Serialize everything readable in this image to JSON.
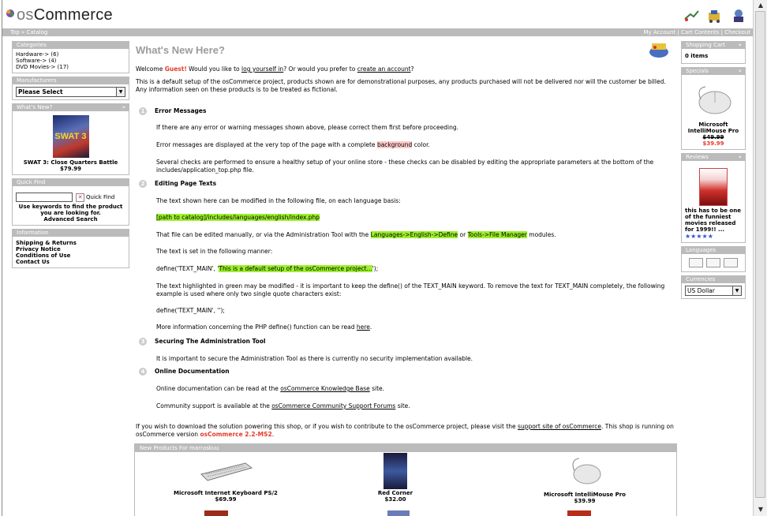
{
  "header": {
    "logo_text_prefix": "os",
    "logo_text_suffix": "Commerce",
    "breadcrumb": "Top » Catalog",
    "nav_right": "My Account | Cart Contents | Checkout"
  },
  "left": {
    "categories": {
      "title": "Categories",
      "items": [
        "Hardware-> (6)",
        "Software-> (4)",
        "DVD Movies-> (17)"
      ]
    },
    "manufacturers": {
      "title": "Manufacturers",
      "selected": "Please Select"
    },
    "whats_new": {
      "title": "What's New?",
      "product": "SWAT 3: Close Quarters Battle",
      "price": "$79.99",
      "img_label": "SWAT 3"
    },
    "quick_find": {
      "title": "Quick Find",
      "button": "Quick Find",
      "hint": "Use keywords to find the product you are looking for.",
      "advanced": "Advanced Search"
    },
    "information": {
      "title": "Information",
      "links": [
        "Shipping & Returns",
        "Privacy Notice",
        "Conditions of Use",
        "Contact Us"
      ]
    }
  },
  "right": {
    "cart": {
      "title": "Shopping Cart",
      "content": "0 items"
    },
    "specials": {
      "title": "Specials",
      "product": "Microsoft IntelliMouse Pro",
      "old_price": "$49.99",
      "new_price": "$39.99"
    },
    "reviews": {
      "title": "Reviews",
      "text": "this has to be one of the funniest movies released for 1999!! ...",
      "stars": "★★★★★"
    },
    "languages": {
      "title": "Languages"
    },
    "currencies": {
      "title": "Currencies",
      "selected": "US Dollar"
    }
  },
  "center": {
    "title": "What's New Here?",
    "welcome_pre": "Welcome ",
    "welcome_guest": "Guest!",
    "welcome_mid": " Would you like to ",
    "welcome_login": "log yourself in",
    "welcome_mid2": "? Or would you prefer to ",
    "welcome_create": "create an account",
    "welcome_end": "?",
    "intro": "This is a default setup of the osCommerce project, products shown are for demonstrational purposes, any products purchased will not be delivered nor will the customer be billed. Any information seen on these products is to be treated as fictional.",
    "s1_num": "1",
    "s1_title": "Error Messages",
    "s1_p1": "If there are any error or warning messages shown above, please correct them first before proceeding.",
    "s1_p2_a": "Error messages are displayed at the very top of the page with a complete ",
    "s1_p2_hl": "background",
    "s1_p2_b": " color.",
    "s1_p3": "Several checks are performed to ensure a healthy setup of your online store - these checks can be disabled by editing the appropriate parameters at the bottom of the includes/application_top.php file.",
    "s2_num": "2",
    "s2_title": "Editing Page Texts",
    "s2_p1": "The text shown here can be modified in the following file, on each language basis:",
    "s2_path": "[path to catalog]/includes/languages/english/index.php",
    "s2_p3_a": "That file can be edited manually, or via the Administration Tool with the ",
    "s2_p3_hl1": "Languages->English->Define",
    "s2_p3_b": " or ",
    "s2_p3_hl2": "Tools->File Manager",
    "s2_p3_c": " modules.",
    "s2_p4": "The text is set in the following manner:",
    "s2_def_a": "define('TEXT_MAIN', '",
    "s2_def_hl": "This is a default setup of the osCommerce project...",
    "s2_def_b": "');",
    "s2_p6": "The text highlighted in green may be modified - it is important to keep the define() of the TEXT_MAIN keyword. To remove the text for TEXT_MAIN completely, the following example is used where only two single quote characters exist:",
    "s2_def2": "define('TEXT_MAIN', '');",
    "s2_p8_a": "More information concerning the PHP define() function can be read ",
    "s2_p8_link": "here",
    "s2_p8_b": ".",
    "s3_num": "3",
    "s3_title": "Securing The Administration Tool",
    "s3_p1": "It is important to secure the Administration Tool as there is currently no security implementation available.",
    "s4_num": "4",
    "s4_title": "Online Documentation",
    "s4_p1_a": "Online documentation can be read at the ",
    "s4_p1_link": "osCommerce Knowledge Base",
    "s4_p1_b": " site.",
    "s4_p2_a": "Community support is available at the ",
    "s4_p2_link": "osCommerce Community Support Forums",
    "s4_p2_b": " site.",
    "footer_a": "If you wish to download the solution powering this shop, or if you wish to contribute to the osCommerce project, please visit the ",
    "footer_link": "support site of osCommerce",
    "footer_b": ". This shop is running on osCommerce version ",
    "footer_version": "osCommerce 2.2-MS2",
    "footer_c": ".",
    "new_products": {
      "title": "New Products For marraskuu",
      "items": [
        {
          "name": "Microsoft Internet Keyboard PS/2",
          "price": "$69.99"
        },
        {
          "name": "Red Corner",
          "price": "$32.00"
        },
        {
          "name": "Microsoft IntelliMouse Pro",
          "price": "$39.99"
        }
      ]
    }
  },
  "colors": {
    "box_header": "#bbbbbb",
    "highlight_green": "#9cf02c",
    "accent_red": "#e43a2b",
    "title_gray": "#9b9b9b"
  }
}
